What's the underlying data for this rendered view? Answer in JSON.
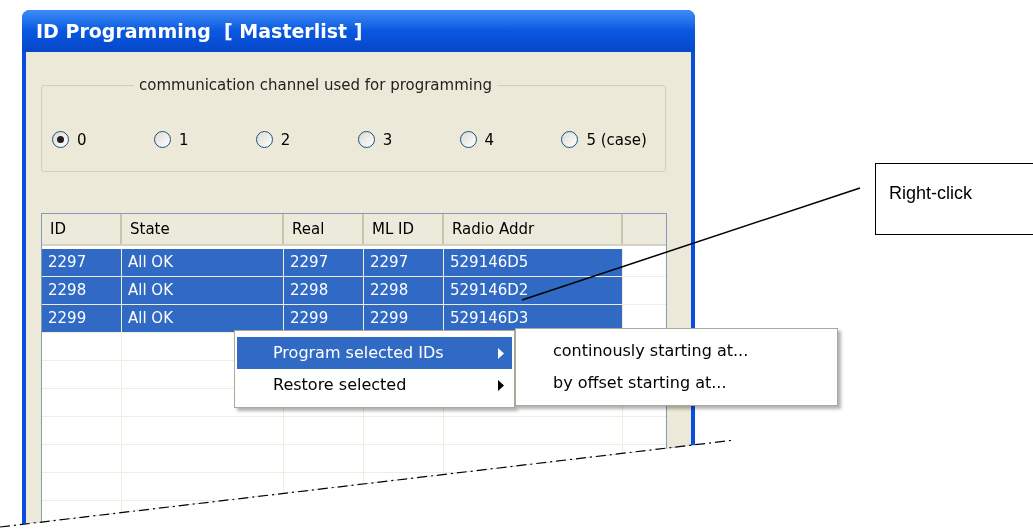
{
  "window": {
    "title": "ID Programming  [ Masterlist ]"
  },
  "channel_group": {
    "legend": "communication channel used for programming",
    "options": [
      {
        "label": "0",
        "selected": true
      },
      {
        "label": "1",
        "selected": false
      },
      {
        "label": "2",
        "selected": false
      },
      {
        "label": "3",
        "selected": false
      },
      {
        "label": "4",
        "selected": false
      },
      {
        "label": "5 (case)",
        "selected": false
      }
    ]
  },
  "table": {
    "columns": [
      "ID",
      "State",
      "Real",
      "ML ID",
      "Radio Addr"
    ],
    "rows": [
      {
        "cells": [
          "2297",
          "All OK",
          "2297",
          "2297",
          "529146D5"
        ],
        "selected": true
      },
      {
        "cells": [
          "2298",
          "All OK",
          "2298",
          "2298",
          "529146D2"
        ],
        "selected": true
      },
      {
        "cells": [
          "2299",
          "All OK",
          "2299",
          "2299",
          "529146D3"
        ],
        "selected": true
      }
    ]
  },
  "context_menu": {
    "items": [
      {
        "label": "Program selected IDs",
        "selected": true,
        "submenu": true
      },
      {
        "label": "Restore selected",
        "selected": false,
        "submenu": true
      }
    ],
    "submenu": {
      "items": [
        {
          "label": "continously starting at..."
        },
        {
          "label": "by offset starting at..."
        }
      ]
    }
  },
  "callout": {
    "text": "Right-click"
  }
}
